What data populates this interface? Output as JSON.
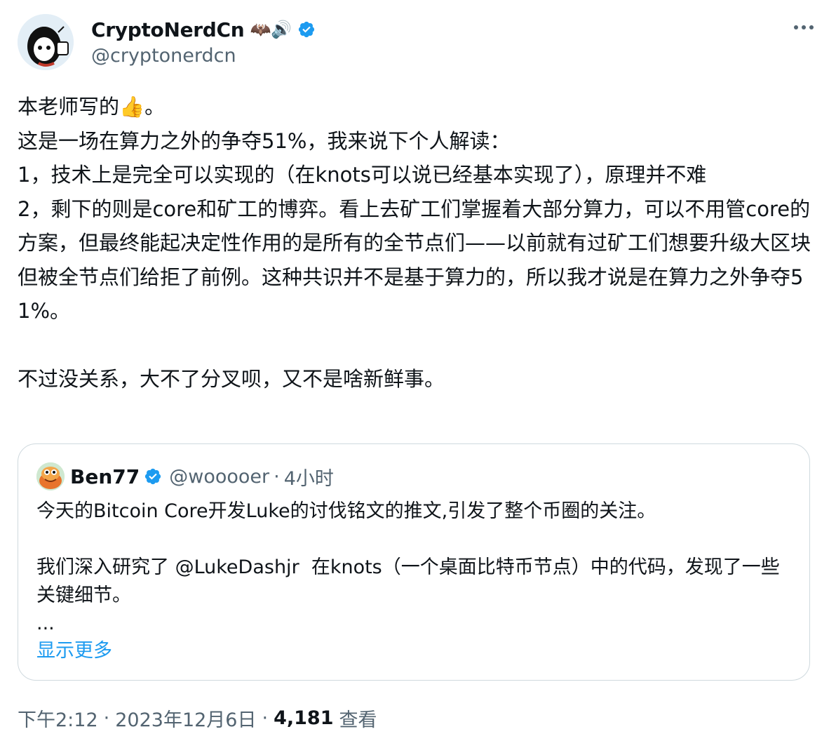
{
  "author": {
    "display_name": "CryptoNerdCn",
    "name_emojis": "🦇🔊",
    "handle": "@cryptonerdcn"
  },
  "tweet": {
    "text": "本老师写的👍。\n这是一场在算力之外的争夺51%，我来说下个人解读：\n1，技术上是完全可以实现的（在knots可以说已经基本实现了），原理并不难\n2，剩下的则是core和矿工的博弈。看上去矿工们掌握着大部分算力，可以不用管core的方案，但最终能起决定性作用的是所有的全节点们——以前就有过矿工们想要升级大区块但被全节点们给拒了前例。这种共识并不是基于算力的，所以我才说是在算力之外争夺51%。\n\n不过没关系，大不了分叉呗，又不是啥新鲜事。"
  },
  "quote": {
    "display_name": "Ben77",
    "handle": "@wooooer",
    "dot": "·",
    "time": "4小时",
    "text": "今天的Bitcoin Core开发Luke的讨伐铭文的推文,引发了整个币圈的关注。\n\n我们深入研究了 @LukeDashjr  在knots（一个桌面比特币节点）中的代码，发现了一些关键细节。\n...",
    "show_more": "显示更多"
  },
  "meta": {
    "time": "下午2:12",
    "sep1": "·",
    "date": "2023年12月6日",
    "sep2": "·",
    "views_count": "4,181",
    "views_label": "查看"
  },
  "colors": {
    "verified": "#1d9bf0",
    "link": "#1d9bf0",
    "secondary_text": "#536471",
    "border": "#cfd9de"
  },
  "icons": {
    "more": "more-horizontal-icon",
    "verified": "verified-badge-icon"
  }
}
